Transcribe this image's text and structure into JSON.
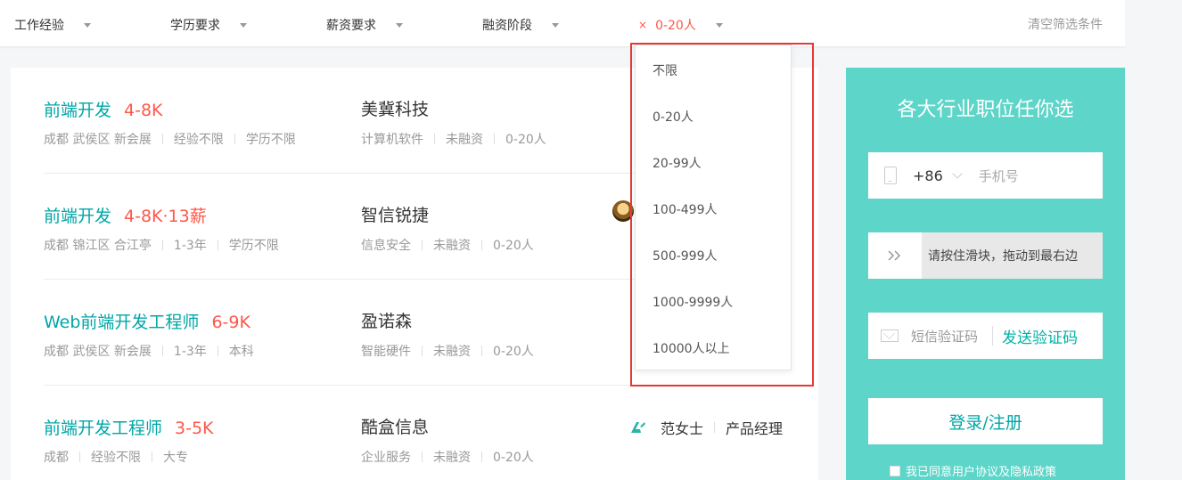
{
  "filters": {
    "experience": "工作经验",
    "education": "学历要求",
    "salary": "薪资要求",
    "financing": "融资阶段",
    "scale": "0-20人",
    "scale_clear": "×",
    "clear_all": "清空筛选条件"
  },
  "dropdown": {
    "options": [
      "不限",
      "0-20人",
      "20-99人",
      "100-499人",
      "500-999人",
      "1000-9999人",
      "10000人以上"
    ]
  },
  "jobs": [
    {
      "title": "前端开发",
      "salary": "4-8K",
      "location": "成都 武侯区 新会展",
      "experience": "经验不限",
      "education": "学历不限",
      "company": "美冀科技",
      "industry": "计算机软件",
      "financing": "未融资",
      "scale": "0-20人"
    },
    {
      "title": "前端开发",
      "salary": "4-8K·13薪",
      "location": "成都 锦江区 合江亭",
      "experience": "1-3年",
      "education": "学历不限",
      "company": "智信锐捷",
      "industry": "信息安全",
      "financing": "未融资",
      "scale": "0-20人"
    },
    {
      "title": "Web前端开发工程师",
      "salary": "6-9K",
      "location": "成都 武侯区 新会展",
      "experience": "1-3年",
      "education": "本科",
      "company": "盈诺森",
      "industry": "智能硬件",
      "financing": "未融资",
      "scale": "0-20人"
    },
    {
      "title": "前端开发工程师",
      "salary": "3-5K",
      "location": "成都",
      "experience": "经验不限",
      "education": "大专",
      "company": "酷盒信息",
      "industry": "企业服务",
      "financing": "未融资",
      "scale": "0-20人"
    }
  ],
  "recruiter": {
    "name": "范女士",
    "position": "产品经理"
  },
  "login": {
    "title": "各大行业职位任你选",
    "country_code": "+86",
    "phone_placeholder": "手机号",
    "slider_text": "请按住滑块，拖动到最右边",
    "sms_placeholder": "短信验证码",
    "send_code": "发送验证码",
    "submit": "登录/注册",
    "agree": "我已同意用户协议及隐私政策"
  },
  "colors": {
    "accent": "#00a6a7",
    "salary": "#fe574a",
    "panel": "#5dd5c8"
  }
}
